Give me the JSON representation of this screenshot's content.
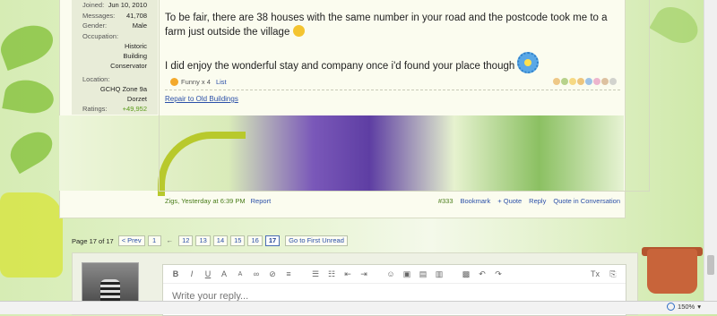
{
  "user_info": {
    "rows": [
      {
        "label": "Joined:",
        "value": "Jun 10, 2010"
      },
      {
        "label": "Messages:",
        "value": "41,708"
      },
      {
        "label": "Gender:",
        "value": "Male"
      }
    ],
    "occupation_label": "Occupation:",
    "occupation_value": "Historic Building Conservator",
    "location_label": "Location:",
    "location_value": "GCHQ Zone 9a Dorzet",
    "ratings_label": "Ratings:",
    "ratings_value": "+49,952"
  },
  "post": {
    "line1": "To be fair, there are 38 houses with the same number in your road and the postcode took me to a farm just outside the village",
    "line2": "I did enjoy the wonderful stay and company once i'd found your place though",
    "rating_summary": "Funny x 4",
    "rating_list_link": "List",
    "signature_link": "Repair to Old Buildings",
    "author_time": "Zigs, Yesterday at 6:39 PM",
    "report": "Report",
    "post_number": "#333",
    "bookmark": "Bookmark",
    "quote": "+ Quote",
    "reply": "Reply",
    "quote_conversation": "Quote in Conversation"
  },
  "pagination": {
    "label": "Page 17 of 17",
    "prev": "< Prev",
    "first": "1",
    "gap": "←",
    "pages": [
      "12",
      "13",
      "14",
      "15",
      "16"
    ],
    "current": "17",
    "go_first_unread": "Go to First Unread"
  },
  "editor": {
    "placeholder": "Write your reply...",
    "toolbar_icons": [
      "bold-icon",
      "italic-icon",
      "underline-icon",
      "font-color-icon",
      "font-size-icon",
      "link-icon",
      "unlink-icon",
      "align-icon",
      "list-icon",
      "numbered-list-icon",
      "outdent-icon",
      "indent-icon",
      "smilie-icon",
      "image-icon",
      "media-icon",
      "code-icon",
      "save-icon",
      "undo-icon",
      "redo-icon",
      "remove-formatting-icon",
      "toggle-bbcode-icon"
    ]
  },
  "status": {
    "zoom": "150%"
  }
}
